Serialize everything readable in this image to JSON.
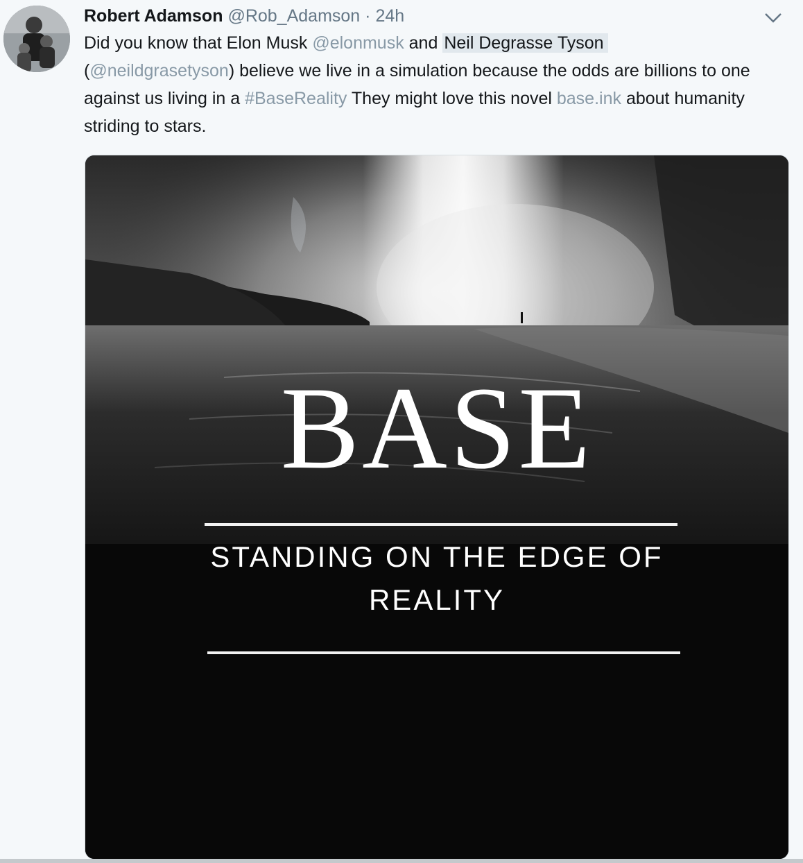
{
  "tweet": {
    "author_name": "Robert Adamson",
    "author_handle": "@Rob_Adamson",
    "separator": "·",
    "timestamp": "24h",
    "text": {
      "p1": "Did you know that Elon Musk ",
      "mention1": "@elonmusk",
      "p2": " and ",
      "highlight": "Neil Degrasse Tyson",
      "p3": "(",
      "mention2": "@neildgrasetyson",
      "p4": ") believe we live in a simulation because the odds are billions to one against us living in a ",
      "hashtag": "#BaseReality",
      "p5": "  They might love this novel ",
      "link": "base.ink",
      "p6": " about humanity striding to stars."
    },
    "media": {
      "title": "BASE",
      "subtitle_line1": "STANDING ON THE EDGE OF",
      "subtitle_line2": "REALITY"
    }
  },
  "icons": {
    "caret": "chevron-down-icon",
    "avatar": "avatar"
  },
  "colors": {
    "link": "#8899a6",
    "text": "#14171a",
    "secondary": "#657786",
    "highlight_bg": "#e1e8ed",
    "background": "#f5f8fa"
  }
}
